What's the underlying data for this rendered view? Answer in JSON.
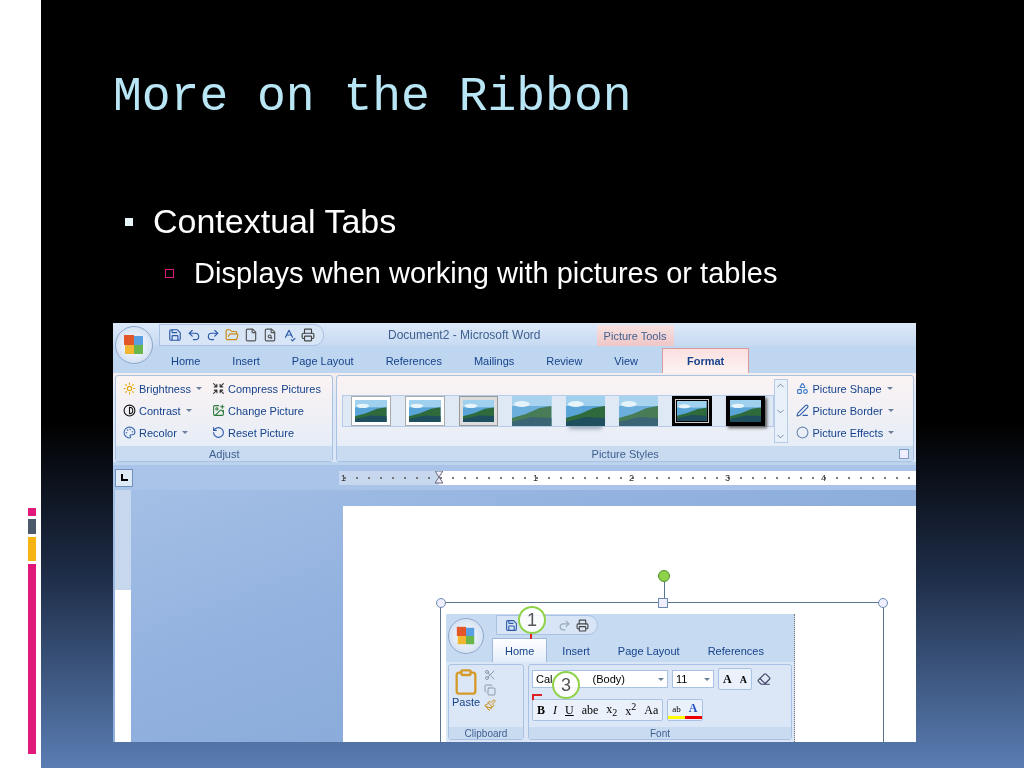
{
  "slide": {
    "title": "More on the Ribbon",
    "bullets": [
      {
        "text": "Contextual Tabs",
        "children": [
          {
            "text": "Displays when working with pictures or tables"
          }
        ]
      }
    ]
  },
  "word": {
    "title": "Document2 - Microsoft Word",
    "context_header": "Picture Tools",
    "tabs": [
      {
        "label": "Home",
        "selected": false,
        "contextual": false
      },
      {
        "label": "Insert",
        "selected": false,
        "contextual": false
      },
      {
        "label": "Page Layout",
        "selected": false,
        "contextual": false
      },
      {
        "label": "References",
        "selected": false,
        "contextual": false
      },
      {
        "label": "Mailings",
        "selected": false,
        "contextual": false
      },
      {
        "label": "Review",
        "selected": false,
        "contextual": false
      },
      {
        "label": "View",
        "selected": false,
        "contextual": false
      },
      {
        "label": "Format",
        "selected": true,
        "contextual": true
      }
    ],
    "adjust_group": {
      "label": "Adjust",
      "commands": [
        {
          "label": "Brightness",
          "dropdown": true
        },
        {
          "label": "Compress Pictures",
          "dropdown": false
        },
        {
          "label": "Contrast",
          "dropdown": true
        },
        {
          "label": "Change Picture",
          "dropdown": false
        },
        {
          "label": "Recolor",
          "dropdown": true
        },
        {
          "label": "Reset Picture",
          "dropdown": false
        }
      ]
    },
    "styles_group": {
      "label": "Picture Styles",
      "styles": [
        {
          "kind": "white-frame"
        },
        {
          "kind": "white-frame"
        },
        {
          "kind": "beveled"
        },
        {
          "kind": "soft"
        },
        {
          "kind": "reflected"
        },
        {
          "kind": "soft"
        },
        {
          "kind": "thick-black"
        },
        {
          "kind": "black-shadow"
        }
      ],
      "commands": [
        {
          "label": "Picture Shape",
          "dropdown": true
        },
        {
          "label": "Picture Border",
          "dropdown": true
        },
        {
          "label": "Picture Effects",
          "dropdown": true
        }
      ]
    },
    "ruler": {
      "labels": [
        "1",
        "1",
        "2",
        "3",
        "4"
      ]
    },
    "embedded_screenshot": {
      "tabs": [
        {
          "label": "Home",
          "selected": true
        },
        {
          "label": "Insert",
          "selected": false
        },
        {
          "label": "Page Layout",
          "selected": false
        },
        {
          "label": "References",
          "selected": false
        }
      ],
      "clipboard_group": {
        "label": "Clipboard",
        "paste_label": "Paste"
      },
      "font_group": {
        "label": "Font",
        "font_name_parts": [
          "Cal",
          "(Body)"
        ],
        "font_size": "11",
        "grow_label": "A",
        "shrink_label": "A",
        "format_buttons": [
          "B",
          "I",
          "U",
          "abe",
          "x$_{2}$",
          "x$^{2}$",
          "Aa"
        ],
        "highlight_label": "ab",
        "font_color_label": "A"
      },
      "callouts": [
        "1",
        "3"
      ]
    }
  }
}
